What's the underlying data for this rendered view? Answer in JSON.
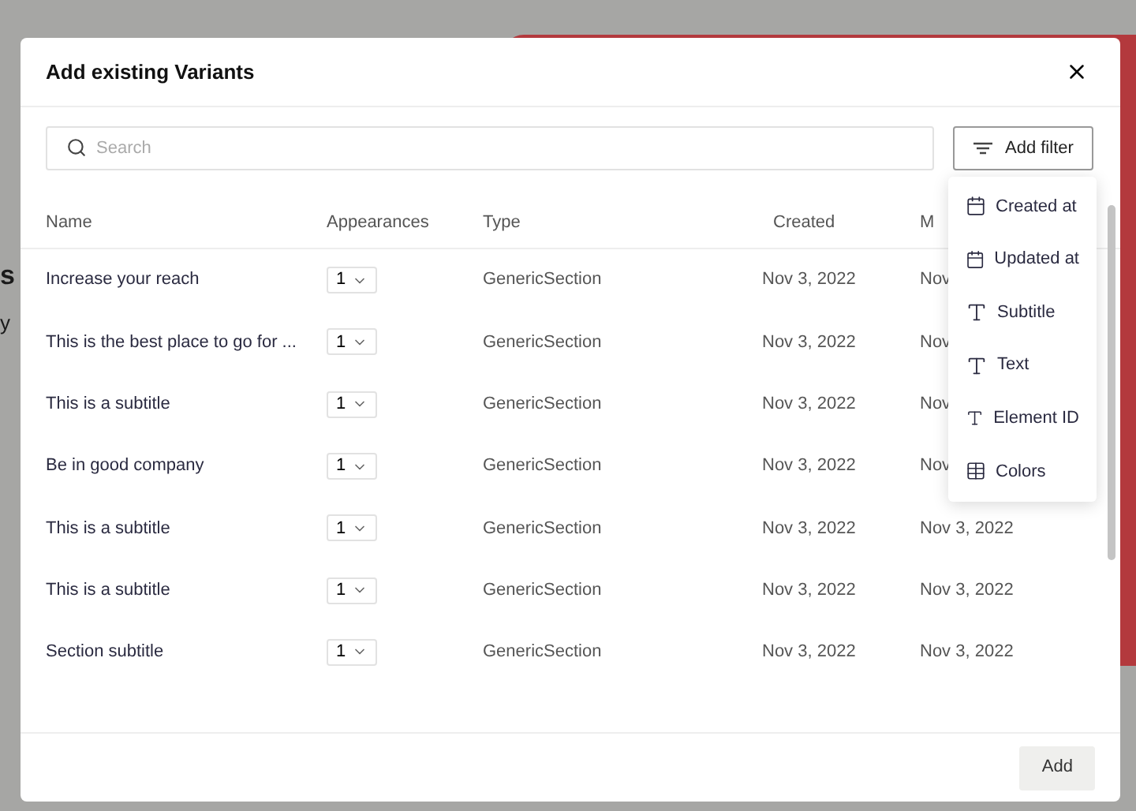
{
  "background": {
    "fragments": [
      {
        "kind": "subheading",
        "text": "s"
      },
      {
        "kind": "body",
        "text": "y"
      }
    ]
  },
  "dialog": {
    "title": "Add existing Variants",
    "search": {
      "placeholder": "Search"
    },
    "filter_button": "Add filter",
    "filter_menu": [
      {
        "kind": "date",
        "label": "Created at"
      },
      {
        "kind": "date",
        "label": "Updated at"
      },
      {
        "kind": "text",
        "label": "Subtitle"
      },
      {
        "kind": "text",
        "label": "Text"
      },
      {
        "kind": "text",
        "label": "Element ID"
      },
      {
        "kind": "table",
        "label": "Colors"
      }
    ],
    "table": {
      "columns": [
        "Name",
        "Appearances",
        "Type",
        "Created",
        "M"
      ],
      "rows": [
        {
          "name": "Increase your reach",
          "appearances": "1",
          "type": "GenericSection",
          "created": "Nov 3, 2022",
          "column_5": "Nov"
        },
        {
          "name": "This is the best place to go for ...",
          "appearances": "1",
          "type": "GenericSection",
          "created": "Nov 3, 2022",
          "column_5": "Nov"
        },
        {
          "name": "This is a subtitle",
          "appearances": "1",
          "type": "GenericSection",
          "created": "Nov 3, 2022",
          "column_5": "Nov"
        },
        {
          "name": "Be in good company",
          "appearances": "1",
          "type": "GenericSection",
          "created": "Nov 3, 2022",
          "column_5": "Nov"
        },
        {
          "name": "This is a subtitle",
          "appearances": "1",
          "type": "GenericSection",
          "created": "Nov 3, 2022",
          "column_5": "Nov 3, 2022"
        },
        {
          "name": "This is a subtitle",
          "appearances": "1",
          "type": "GenericSection",
          "created": "Nov 3, 2022",
          "column_5": "Nov 3, 2022"
        },
        {
          "name": "Section subtitle",
          "appearances": "1",
          "type": "GenericSection",
          "created": "Nov 3, 2022",
          "column_5": "Nov 3, 2022"
        }
      ]
    },
    "add_button": "Add"
  }
}
